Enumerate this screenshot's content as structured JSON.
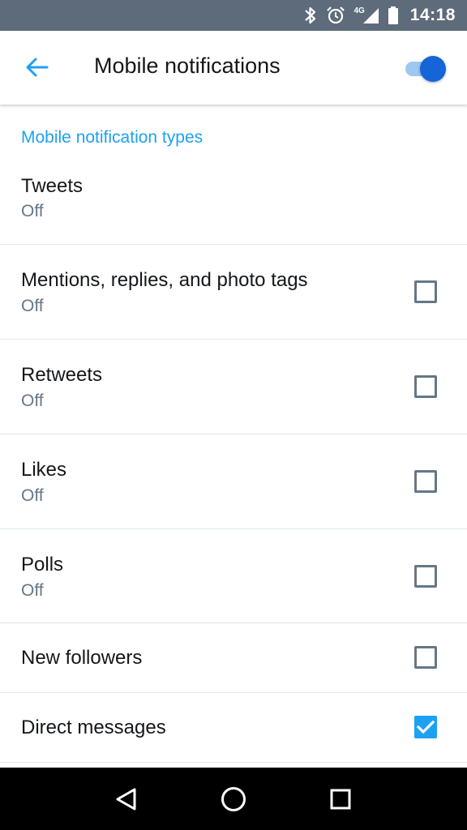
{
  "status_bar": {
    "time": "14:18",
    "network": "4G",
    "icons": [
      "bluetooth-icon",
      "alarm-icon",
      "signal-icon",
      "battery-icon"
    ]
  },
  "app_bar": {
    "title": "Mobile notifications",
    "back_icon": "arrow-left-icon",
    "master_toggle_on": true
  },
  "section": {
    "header": "Mobile notification types"
  },
  "items": [
    {
      "title": "Tweets",
      "subtitle": "Off",
      "has_checkbox": false,
      "checked": false
    },
    {
      "title": "Mentions, replies, and photo tags",
      "subtitle": "Off",
      "has_checkbox": true,
      "checked": false
    },
    {
      "title": "Retweets",
      "subtitle": "Off",
      "has_checkbox": true,
      "checked": false
    },
    {
      "title": "Likes",
      "subtitle": "Off",
      "has_checkbox": true,
      "checked": false
    },
    {
      "title": "Polls",
      "subtitle": "Off",
      "has_checkbox": true,
      "checked": false
    },
    {
      "title": "New followers",
      "subtitle": "",
      "has_checkbox": true,
      "checked": false
    },
    {
      "title": "Direct messages",
      "subtitle": "",
      "has_checkbox": true,
      "checked": true
    }
  ],
  "nav_bar": {
    "buttons": [
      "back-triangle-icon",
      "home-circle-icon",
      "recents-square-icon"
    ]
  },
  "colors": {
    "accent": "#1da1f2",
    "toggle_knob": "#1565d8",
    "status_bar": "#5d6b7a",
    "text_secondary": "#657786"
  }
}
